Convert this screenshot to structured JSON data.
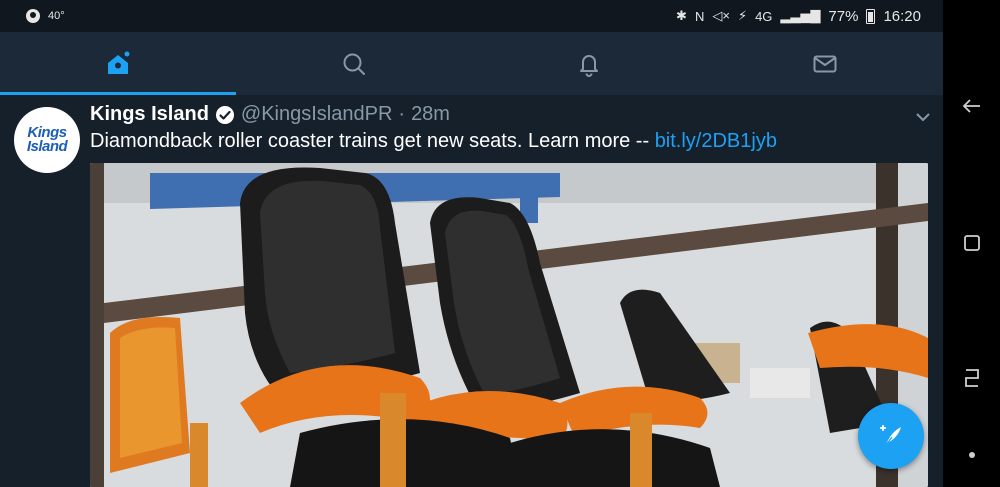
{
  "status_bar": {
    "temperature": "40°",
    "battery_percent": "77%",
    "time": "16:20",
    "icons": [
      "bluetooth-icon",
      "nfc-icon",
      "mute-icon",
      "data-saver-icon",
      "4g-lte-icon",
      "signal-icon"
    ]
  },
  "tabs": [
    {
      "name": "home",
      "icon": "home-icon",
      "active": true
    },
    {
      "name": "search",
      "icon": "search-icon",
      "active": false
    },
    {
      "name": "notifications",
      "icon": "bell-icon",
      "active": false
    },
    {
      "name": "messages",
      "icon": "mail-icon",
      "active": false
    }
  ],
  "tweet": {
    "avatar_text_line1": "Kings",
    "avatar_text_line2": "Island",
    "user_name": "Kings Island",
    "handle": "@KingsIslandPR",
    "separator": "·",
    "time": "28m",
    "text": "Diamondback roller coaster trains get new seats. Learn more -- ",
    "link": "bit.ly/2DB1jyb",
    "media_alt_icon": "photo-roller-coaster-seats"
  },
  "fab": {
    "icon": "compose-tweet-icon"
  },
  "nav_bar": {
    "icons": [
      "back-icon",
      "recents-icon",
      "overview-icon",
      "dot-icon"
    ]
  },
  "colors": {
    "background": "#15202b",
    "tab_bar": "#1c2938",
    "accent": "#1da1f2",
    "secondary_text": "#8899a6"
  }
}
